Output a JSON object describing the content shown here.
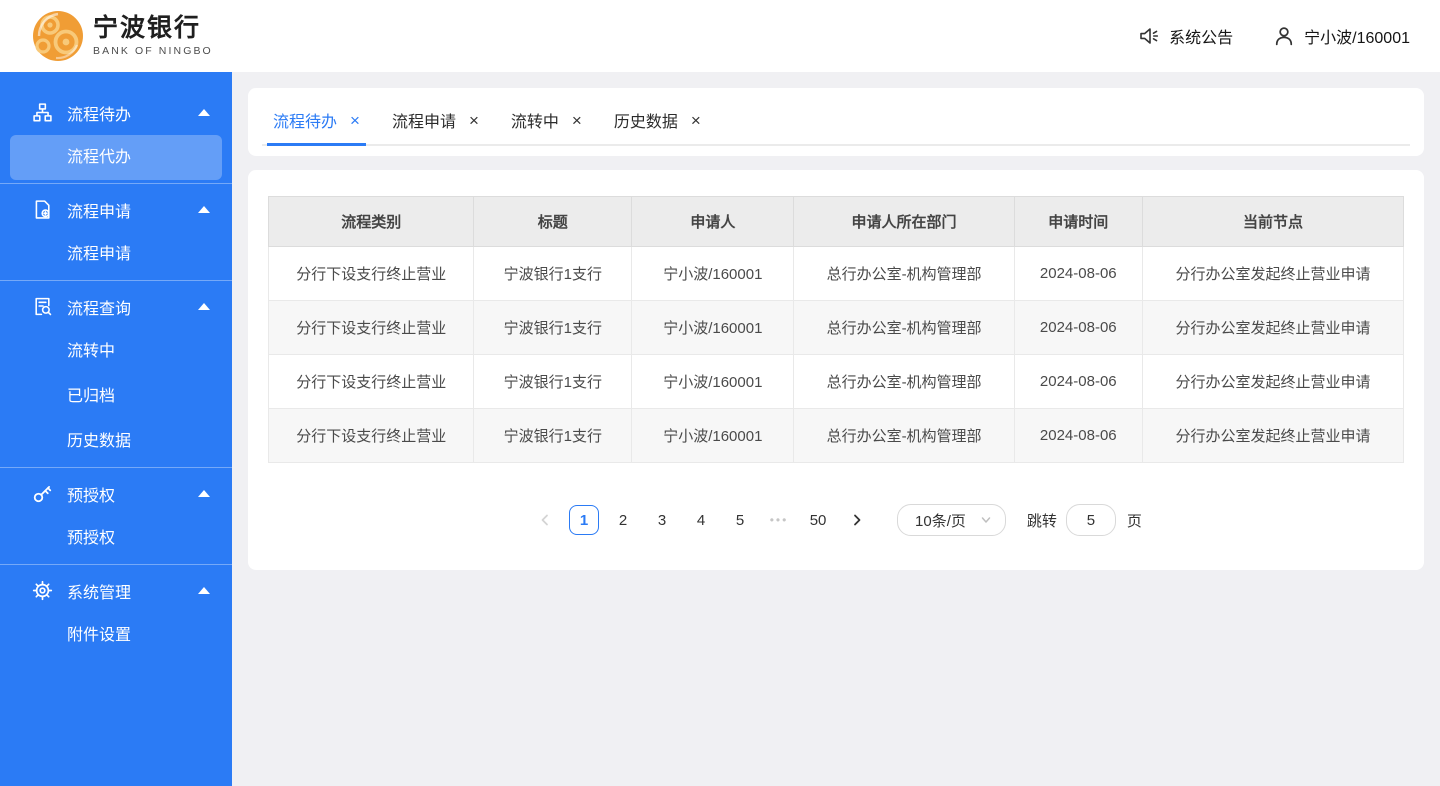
{
  "colors": {
    "sidebar_blue": "#2b7bf5",
    "accent_blue": "#2b7bf5",
    "logo_orange": "#f09d35",
    "main_background": "#f0f0f3",
    "table_header_bg": "#ececec",
    "stripe_row_bg": "#f7f7f7"
  },
  "header": {
    "logo_cn": "宁波银行",
    "logo_en": "BANK OF NINGBO",
    "announcement": "系统公告",
    "user": "宁小波/160001"
  },
  "sidebar": {
    "groups": [
      {
        "icon": "org-chart-icon",
        "label": "流程待办",
        "children": [
          {
            "label": "流程代办",
            "active": true
          }
        ]
      },
      {
        "icon": "file-add-icon",
        "label": "流程申请",
        "children": [
          {
            "label": "流程申请"
          }
        ]
      },
      {
        "icon": "file-search-icon",
        "label": "流程查询",
        "children": [
          {
            "label": "流转中"
          },
          {
            "label": "已归档"
          },
          {
            "label": "历史数据"
          }
        ]
      },
      {
        "icon": "key-icon",
        "label": "预授权",
        "children": [
          {
            "label": "预授权"
          }
        ]
      },
      {
        "icon": "gear-icon",
        "label": "系统管理",
        "children": [
          {
            "label": "附件设置"
          }
        ]
      }
    ]
  },
  "tabs": [
    {
      "label": "流程待办",
      "active": true
    },
    {
      "label": "流程申请",
      "active": false
    },
    {
      "label": "流转中",
      "active": false
    },
    {
      "label": "历史数据",
      "active": false
    }
  ],
  "table": {
    "columns": [
      "流程类别",
      "标题",
      "申请人",
      "申请人所在部门",
      "申请时间",
      "当前节点"
    ],
    "rows": [
      [
        "分行下设支行终止营业",
        "宁波银行1支行",
        "宁小波/160001",
        "总行办公室-机构管理部",
        "2024-08-06",
        "分行办公室发起终止营业申请"
      ],
      [
        "分行下设支行终止营业",
        "宁波银行1支行",
        "宁小波/160001",
        "总行办公室-机构管理部",
        "2024-08-06",
        "分行办公室发起终止营业申请"
      ],
      [
        "分行下设支行终止营业",
        "宁波银行1支行",
        "宁小波/160001",
        "总行办公室-机构管理部",
        "2024-08-06",
        "分行办公室发起终止营业申请"
      ],
      [
        "分行下设支行终止营业",
        "宁波银行1支行",
        "宁小波/160001",
        "总行办公室-机构管理部",
        "2024-08-06",
        "分行办公室发起终止营业申请"
      ]
    ]
  },
  "pagination": {
    "pages": [
      "1",
      "2",
      "3",
      "4",
      "5"
    ],
    "ellipsis": "•••",
    "last_page": "50",
    "current": "1",
    "page_size": "10条/页",
    "jump_label": "跳转",
    "jump_value": "5",
    "jump_suffix": "页"
  }
}
